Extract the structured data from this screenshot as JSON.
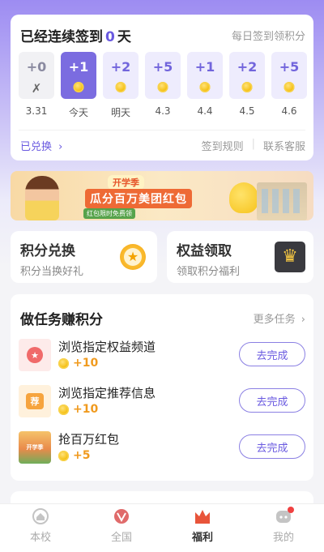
{
  "signin": {
    "title_prefix": "已经连续签到",
    "streak": "0",
    "title_suffix": "天",
    "daily_label": "每日签到领积分",
    "days": [
      {
        "points": "+0",
        "label": "3.31",
        "state": "past"
      },
      {
        "points": "+1",
        "label": "今天",
        "state": "active"
      },
      {
        "points": "+2",
        "label": "明天",
        "state": "future"
      },
      {
        "points": "+5",
        "label": "4.3",
        "state": "future"
      },
      {
        "points": "+1",
        "label": "4.4",
        "state": "future"
      },
      {
        "points": "+2",
        "label": "4.5",
        "state": "future"
      },
      {
        "points": "+5",
        "label": "4.6",
        "state": "future"
      }
    ],
    "past_icon": "✗",
    "redeemed_link": "已兑换",
    "rules_link": "签到规则",
    "contact_link": "联系客服"
  },
  "banner": {
    "tag": "开学季",
    "title": "瓜分百万美团红包",
    "sub": "红包限时免费领"
  },
  "exchange": {
    "title": "积分兑换",
    "subtitle": "积分当换好礼",
    "icon": "star-icon"
  },
  "rights": {
    "title": "权益领取",
    "subtitle": "领取积分福利",
    "icon": "crown-icon"
  },
  "tasks": {
    "title": "做任务赚积分",
    "more": "更多任务",
    "items": [
      {
        "name": "浏览指定权益频道",
        "reward": "+10",
        "button": "去完成",
        "icon": "medal-icon",
        "badge": "★"
      },
      {
        "name": "浏览指定推荐信息",
        "reward": "+10",
        "button": "去完成",
        "icon": "recommend-icon",
        "badge": "荐"
      },
      {
        "name": "抢百万红包",
        "reward": "+5",
        "button": "去完成",
        "icon": "red-packet-icon",
        "badge": "开学季"
      }
    ]
  },
  "nav": [
    {
      "label": "本校",
      "icon": "campus-icon"
    },
    {
      "label": "全国",
      "icon": "national-icon"
    },
    {
      "label": "福利",
      "icon": "welfare-icon",
      "active": true
    },
    {
      "label": "我的",
      "icon": "profile-icon"
    }
  ],
  "colors": {
    "accent": "#6a5ae0",
    "coin": "#f5c21b",
    "reward": "#f09a1e",
    "badge": "#f04141"
  }
}
